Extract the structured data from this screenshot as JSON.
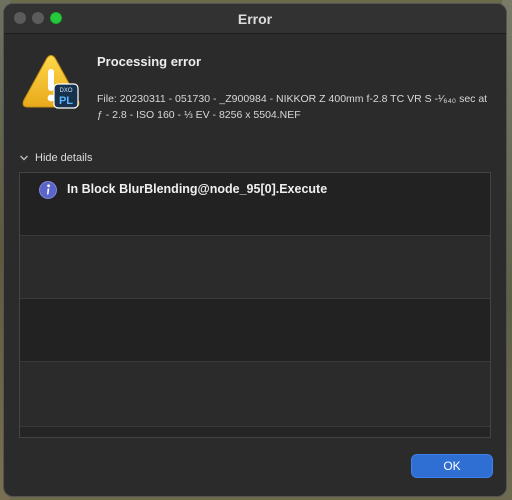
{
  "window": {
    "title": "Error"
  },
  "dialog": {
    "heading": "Processing error",
    "file_info": "File: 20230311 - 051730 - _Z900984 - NIKKOR Z 400mm f-2.8 TC VR S -¹⁄₆₄₀ sec at ƒ - 2.8 - ISO 160 - ⅓ EV - 8256 x 5504.NEF",
    "badge_line1": "DXO",
    "badge_line2": "PL"
  },
  "details": {
    "toggle_label": "Hide details",
    "rows": [
      {
        "text": "In Block BlurBlending@node_95[0].Execute",
        "icon": "info-icon"
      },
      {
        "text": ""
      },
      {
        "text": ""
      },
      {
        "text": ""
      }
    ]
  },
  "buttons": {
    "ok_label": "OK"
  },
  "colors": {
    "accent": "#2f6fd3",
    "window_bg": "#2b2b2b",
    "warning": "#f2c12e"
  }
}
